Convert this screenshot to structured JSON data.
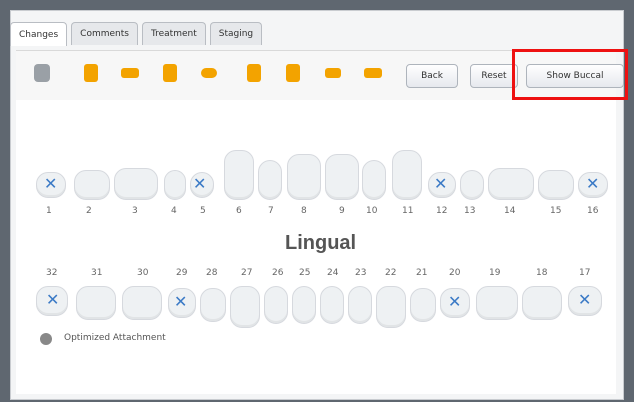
{
  "tabs": [
    "Changes",
    "Comments",
    "Treatment",
    "Staging"
  ],
  "toolbar": {
    "back_label": "Back",
    "reset_label": "Reset",
    "show_buccal_label": "Show Buccal"
  },
  "upper": {
    "numbers": [
      "1",
      "2",
      "3",
      "4",
      "5",
      "6",
      "7",
      "8",
      "9",
      "10",
      "11",
      "12",
      "13",
      "14",
      "15",
      "16"
    ]
  },
  "lower": {
    "numbers": [
      "32",
      "31",
      "30",
      "29",
      "28",
      "27",
      "26",
      "25",
      "24",
      "23",
      "22",
      "21",
      "20",
      "19",
      "18",
      "17"
    ]
  },
  "section_label": "Lingual",
  "legend": {
    "text": "Optimized Attachment"
  },
  "colors": {
    "accent": "#f3a300",
    "highlight": "#e11"
  }
}
